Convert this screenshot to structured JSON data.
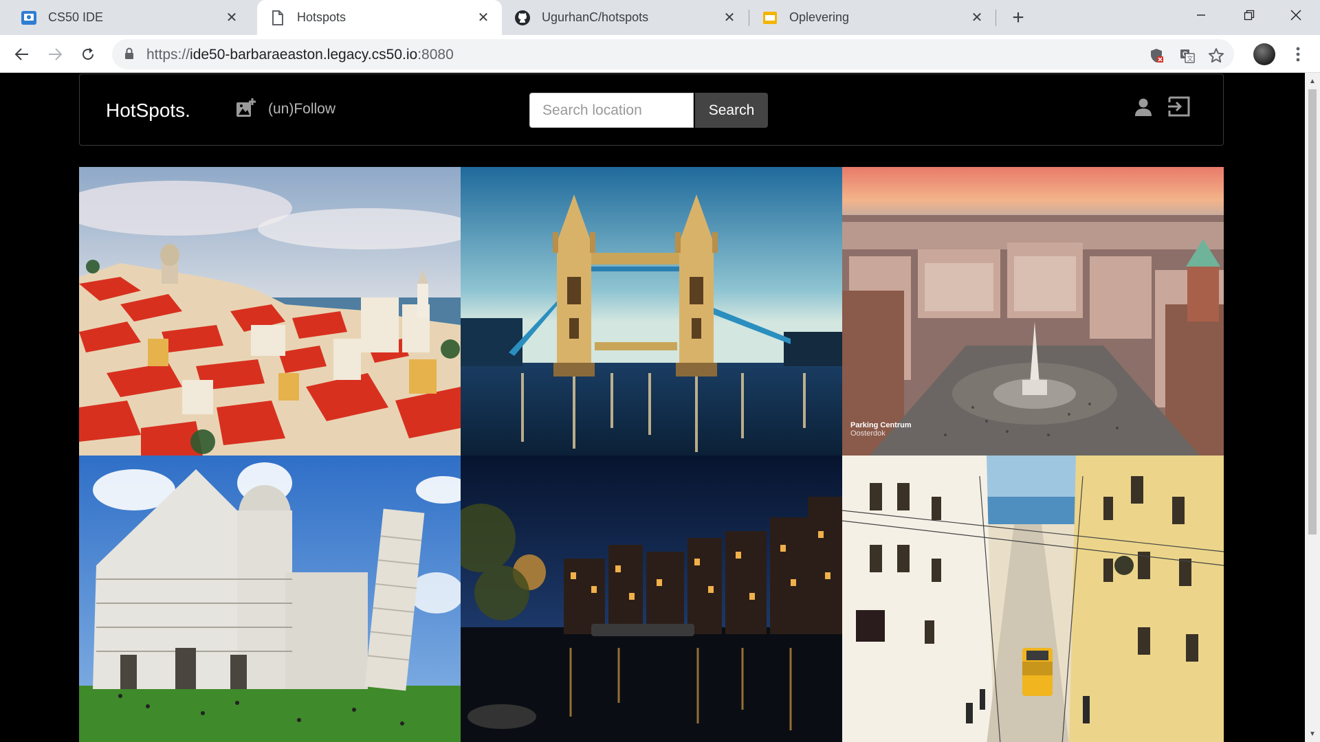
{
  "browser": {
    "tabs": [
      {
        "title": "CS50 IDE",
        "active": false
      },
      {
        "title": "Hotspots",
        "active": true
      },
      {
        "title": "UgurhanC/hotspots",
        "active": false
      },
      {
        "title": "Oplevering",
        "active": false
      }
    ],
    "url": {
      "scheme": "https://",
      "host": "ide50-barbaraeaston.legacy.cs50.io",
      "port": ":8080"
    }
  },
  "navbar": {
    "brand": "HotSpots.",
    "follow_label": "(un)Follow",
    "search_placeholder": "Search location",
    "search_button": "Search"
  },
  "gallery": {
    "photos": [
      {
        "name": "lisbon-rooftops",
        "icon": "photo"
      },
      {
        "name": "tower-bridge-london",
        "icon": "photo"
      },
      {
        "name": "amsterdam-dam-square",
        "icon": "photo",
        "overlay_text": "Parking Centrum",
        "overlay_sub": "Oosterdok"
      },
      {
        "name": "pisa-cathedral-tower",
        "icon": "photo"
      },
      {
        "name": "amsterdam-canal-night",
        "icon": "photo"
      },
      {
        "name": "lisbon-tram-street",
        "icon": "photo"
      }
    ]
  },
  "colors": {
    "page_bg": "#000000",
    "accent_button": "#444444",
    "tab_strip": "#dee1e6"
  }
}
